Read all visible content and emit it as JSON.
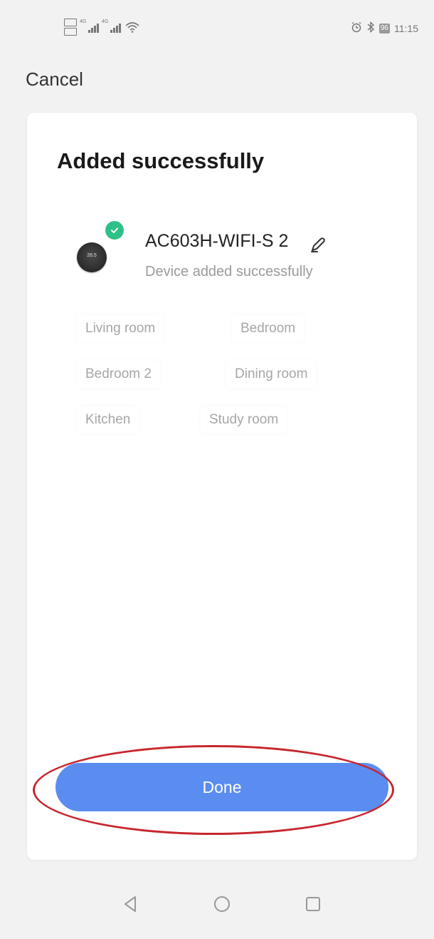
{
  "status_bar": {
    "time": "11:15",
    "battery": "96"
  },
  "header": {
    "cancel_label": "Cancel"
  },
  "card": {
    "title": "Added successfully",
    "device": {
      "name": "AC603H-WIFI-S 2",
      "status": "Device added successfully",
      "icon": "thermostat-icon"
    },
    "rooms": [
      "Living room",
      "Bedroom",
      "Bedroom 2",
      "Dining room",
      "Kitchen",
      "Study room"
    ],
    "done_label": "Done"
  },
  "colors": {
    "accent": "#5b8df0",
    "success": "#2fc089",
    "highlight": "#c8262e"
  }
}
